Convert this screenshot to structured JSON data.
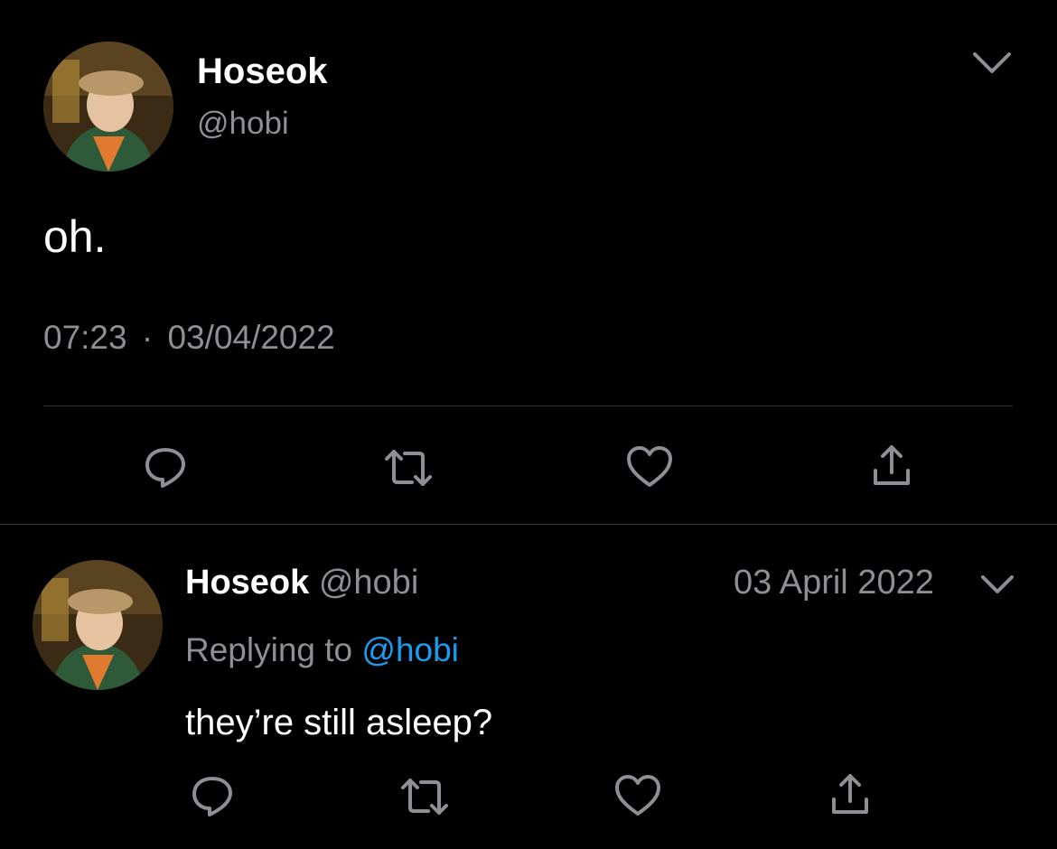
{
  "main_tweet": {
    "display_name": "Hoseok",
    "handle": "@hobi",
    "text": "oh.",
    "time": "07:23",
    "separator": "·",
    "date": "03/04/2022",
    "actions": [
      "reply-icon",
      "retweet-icon",
      "like-icon",
      "share-icon"
    ]
  },
  "reply_tweet": {
    "display_name": "Hoseok",
    "handle": "@hobi",
    "date": "03 April 2022",
    "replying_prefix": "Replying to",
    "replying_handle": "@hobi",
    "text": "they’re still asleep?",
    "actions": [
      "reply-icon",
      "retweet-icon",
      "like-icon",
      "share-icon"
    ]
  },
  "colors": {
    "background": "#000000",
    "text": "#ffffff",
    "muted": "#8e8e93",
    "link": "#1d9bf0",
    "divider": "#3a3a3c"
  }
}
